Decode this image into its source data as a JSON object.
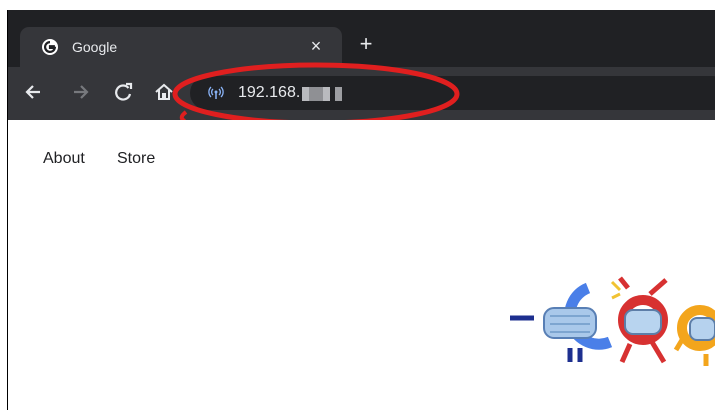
{
  "browser": {
    "tab": {
      "title": "Google",
      "close_icon": "×"
    },
    "new_tab_icon": "+",
    "address_bar": {
      "url": "192.168."
    }
  },
  "page": {
    "nav_links": [
      "About",
      "Store"
    ]
  },
  "colors": {
    "chrome_bg": "#202124",
    "toolbar_bg": "#35363a",
    "annotation_red": "#e01f1f",
    "text_light": "#e8eaed"
  }
}
